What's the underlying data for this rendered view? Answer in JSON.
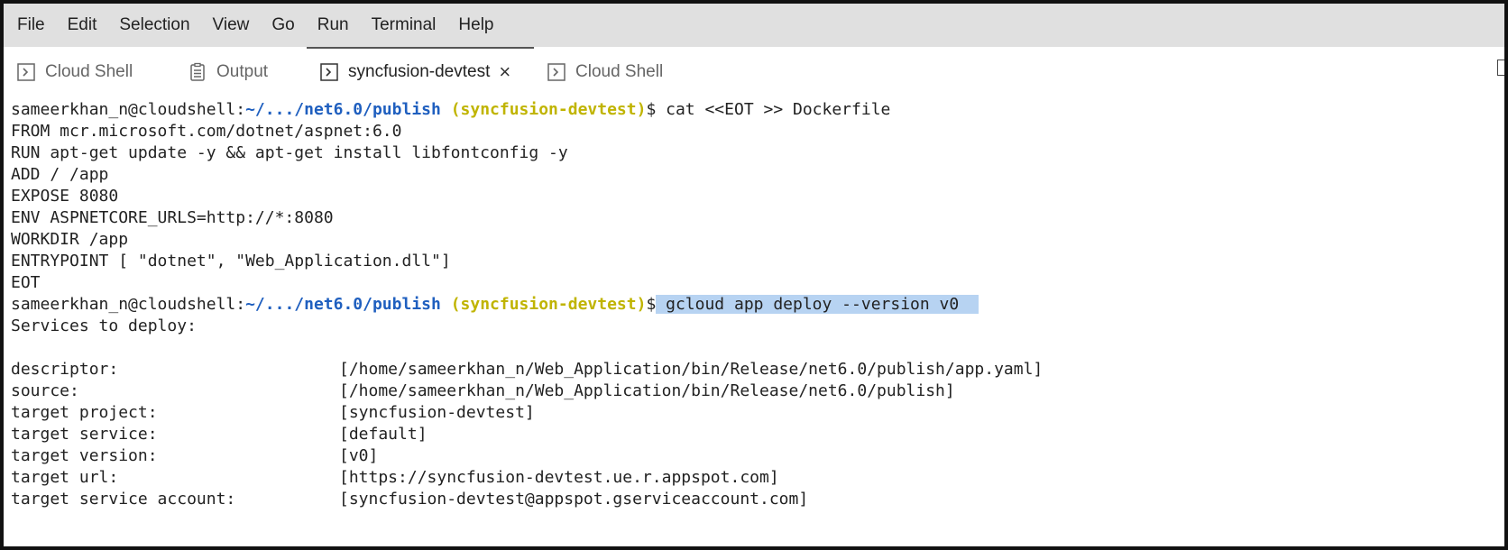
{
  "menu": [
    "File",
    "Edit",
    "Selection",
    "View",
    "Go",
    "Run",
    "Terminal",
    "Help"
  ],
  "tabs": [
    {
      "label": "Cloud Shell",
      "icon": "terminal-icon"
    },
    {
      "label": "Output",
      "icon": "output-icon"
    },
    {
      "label": "syncfusion-devtest",
      "icon": "terminal-icon",
      "active": true
    },
    {
      "label": "Cloud Shell",
      "icon": "terminal-icon"
    }
  ],
  "terminal": {
    "prompt": {
      "user": "sameerkhan_n@cloudshell:",
      "path": "~/.../net6.0/publish",
      "project": "(syncfusion-devtest)",
      "symbol": "$"
    },
    "cmd1": " cat <<EOT >> Dockerfile",
    "heredoc": [
      "FROM mcr.microsoft.com/dotnet/aspnet:6.0",
      "RUN apt-get update -y && apt-get install libfontconfig -y",
      "ADD / /app",
      "EXPOSE 8080",
      "ENV ASPNETCORE_URLS=http://*:8080",
      "WORKDIR /app",
      "ENTRYPOINT [ \"dotnet\", \"Web_Application.dll\"]",
      "EOT"
    ],
    "cmd2": " gcloud app deploy --version v0  ",
    "services_header": "Services to deploy:",
    "details": [
      {
        "key": "descriptor:",
        "value": "[/home/sameerkhan_n/Web_Application/bin/Release/net6.0/publish/app.yaml]"
      },
      {
        "key": "source:",
        "value": "[/home/sameerkhan_n/Web_Application/bin/Release/net6.0/publish]"
      },
      {
        "key": "target project:",
        "value": "[syncfusion-devtest]"
      },
      {
        "key": "target service:",
        "value": "[default]"
      },
      {
        "key": "target version:",
        "value": "[v0]"
      },
      {
        "key": "target url:",
        "value": "[https://syncfusion-devtest.ue.r.appspot.com]"
      },
      {
        "key": "target service account:",
        "value": "[syncfusion-devtest@appspot.gserviceaccount.com]"
      }
    ]
  },
  "colors": {
    "path": "#1f5fbf",
    "project": "#c0b400",
    "selection": "#b7d3f2",
    "menubar": "#e0e0e0"
  }
}
